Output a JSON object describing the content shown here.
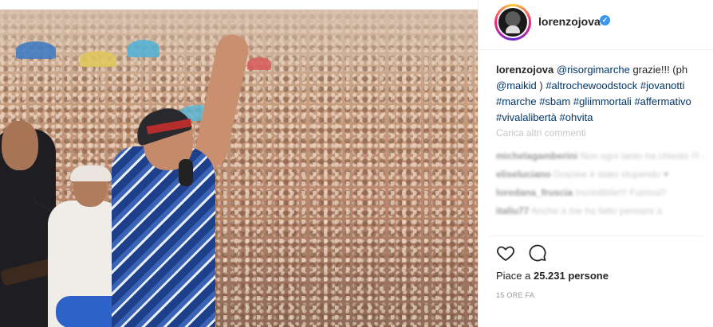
{
  "post": {
    "username": "lorenzojova",
    "verified": true,
    "caption": {
      "author": "lorenzojova",
      "text_parts": [
        {
          "text": "@risorgimarche",
          "tag": true
        },
        {
          "text": " grazie!!! (ph ",
          "tag": false
        },
        {
          "text": "@maikid",
          "tag": true
        },
        {
          "text": " ) ",
          "tag": false
        },
        {
          "text": "#altrochewoodstock",
          "tag": true
        },
        {
          "text": " ",
          "tag": false
        },
        {
          "text": "#jovanotti",
          "tag": true
        },
        {
          "text": " ",
          "tag": false
        },
        {
          "text": "#marche",
          "tag": true
        },
        {
          "text": " ",
          "tag": false
        },
        {
          "text": "#sbam",
          "tag": true
        },
        {
          "text": " ",
          "tag": false
        },
        {
          "text": "#gliimmortali",
          "tag": true
        },
        {
          "text": " ",
          "tag": false
        },
        {
          "text": "#affermativo",
          "tag": true
        },
        {
          "text": " ",
          "tag": false
        },
        {
          "text": "#vivalalibertà",
          "tag": true
        },
        {
          "text": " ",
          "tag": false
        },
        {
          "text": "#ohvita",
          "tag": true
        }
      ]
    },
    "load_comments": "Carica altri commenti",
    "comments": [
      {
        "user": "michelagamberini",
        "text": "Non ogni tanto ha chiesto !!! @xxxxxxxxxxxxxxxx"
      },
      {
        "user": "eliseluciano",
        "text": "Graziee è stato stupendo ♥"
      },
      {
        "user": "loredana_fruscia",
        "text": "Incredibile!!! Fumosi!!"
      },
      {
        "user": "italiu77",
        "text": "Anche a me ha fatto pensare a"
      }
    ],
    "likes_prefix": "Piace a ",
    "likes_count": "25.231",
    "likes_suffix": " persone",
    "timestamp": "15 ORE FA"
  },
  "icons": {
    "like": "heart-icon",
    "comment": "comment-icon",
    "verified": "verified-badge-icon"
  },
  "colors": {
    "tag": "#003569",
    "verified": "#3897f0",
    "text": "#262626",
    "muted": "#999999"
  }
}
